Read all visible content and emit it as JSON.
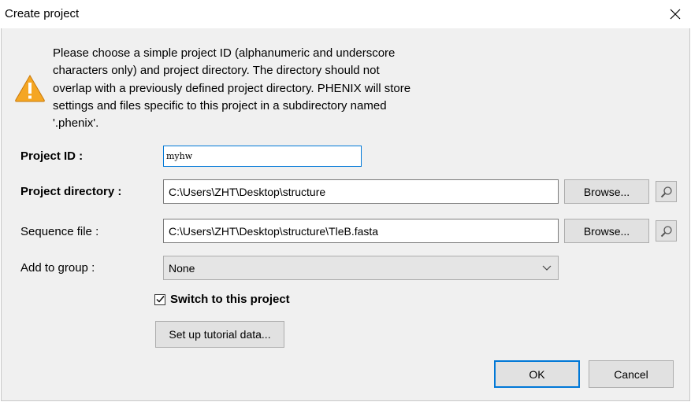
{
  "window": {
    "title": "Create project",
    "close_icon": "close-icon"
  },
  "message": "Please choose a simple project ID (alphanumeric and underscore\ncharacters only) and project directory.  The directory should not\noverlap with a previously defined project directory.  PHENIX will store\nsettings and files specific to this project in a subdirectory named\n'.phenix'.",
  "form": {
    "project_id": {
      "label": "Project ID :",
      "value": "myhw"
    },
    "project_directory": {
      "label": "Project directory :",
      "value": "C:\\Users\\ZHT\\Desktop\\structure",
      "browse_label": "Browse..."
    },
    "sequence_file": {
      "label": "Sequence file :",
      "value": "C:\\Users\\ZHT\\Desktop\\structure\\TleB.fasta",
      "browse_label": "Browse..."
    },
    "group": {
      "label": "Add to group :",
      "selected": "None"
    },
    "switch_project": {
      "label": "Switch to this project",
      "checked": true
    },
    "tutorial_label": "Set up tutorial data..."
  },
  "buttons": {
    "ok": "OK",
    "cancel": "Cancel"
  },
  "colors": {
    "accent": "#0078d7",
    "warning": "#f5a623"
  }
}
